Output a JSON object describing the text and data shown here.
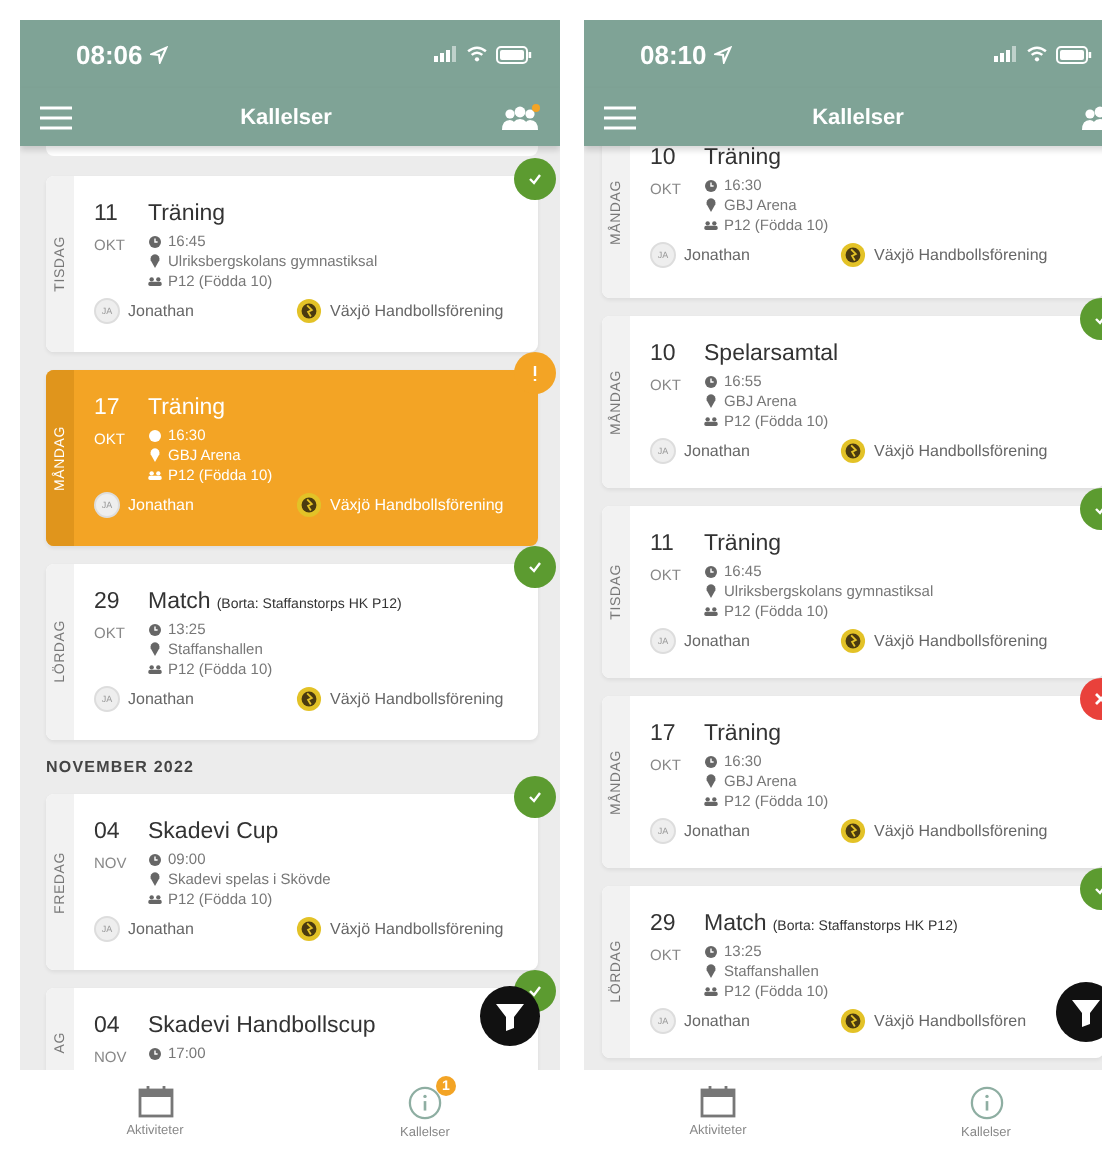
{
  "phones": [
    {
      "status_bar": {
        "time": "08:06"
      },
      "nav": {
        "title": "Kallelser",
        "notification_dot": true
      },
      "items": [
        {
          "kind": "edge"
        },
        {
          "kind": "accepted",
          "weekday": "TISDAG",
          "day": "11",
          "month": "OKT",
          "title": "Träning",
          "time": "16:45",
          "place": "Ulriksbergskolans gymnastiksal",
          "team": "P12 (Födda 10)",
          "initials": "JA",
          "person": "Jonathan",
          "club": "Växjö Handbollsförening"
        },
        {
          "kind": "pending",
          "weekday": "MÅNDAG",
          "day": "17",
          "month": "OKT",
          "title": "Träning",
          "time": "16:30",
          "place": "GBJ Arena",
          "team": "P12 (Födda 10)",
          "initials": "JA",
          "person": "Jonathan",
          "club": "Växjö Handbollsförening"
        },
        {
          "kind": "accepted",
          "weekday": "LÖRDAG",
          "day": "29",
          "month": "OKT",
          "title": "Match",
          "subtitle": "(Borta: Staffanstorps HK P12)",
          "time": "13:25",
          "place": "Staffanshallen",
          "team": "P12 (Födda 10)",
          "initials": "JA",
          "person": "Jonathan",
          "club": "Växjö Handbollsförening"
        },
        {
          "kind": "section",
          "label": "NOVEMBER 2022"
        },
        {
          "kind": "accepted",
          "weekday": "FREDAG",
          "day": "04",
          "month": "NOV",
          "title": "Skadevi Cup",
          "time": "09:00",
          "place": "Skadevi spelas i Skövde",
          "team": "P12 (Födda 10)",
          "initials": "JA",
          "person": "Jonathan",
          "club": "Växjö Handbollsförening"
        },
        {
          "kind": "accepted",
          "weekday": "AG",
          "day": "04",
          "month": "NOV",
          "title": "Skadevi Handbollscup",
          "time": "17:00"
        }
      ],
      "tabs": [
        {
          "label": "Aktiviteter",
          "selected": false
        },
        {
          "label": "Kallelser",
          "selected": true,
          "badge": "1"
        }
      ]
    },
    {
      "status_bar": {
        "time": "08:10"
      },
      "nav": {
        "title": "Kallelser"
      },
      "items": [
        {
          "kind": "cut",
          "weekday": "MÅNDAG",
          "day": "10",
          "month": "OKT",
          "title": "Träning",
          "time": "16:30",
          "place": "GBJ Arena",
          "team": "P12 (Födda 10)",
          "initials": "JA",
          "person": "Jonathan",
          "club": "Växjö Handbollsförening"
        },
        {
          "kind": "accepted",
          "weekday": "MÅNDAG",
          "day": "10",
          "month": "OKT",
          "title": "Spelarsamtal",
          "time": "16:55",
          "place": "GBJ Arena",
          "team": "P12 (Födda 10)",
          "initials": "JA",
          "person": "Jonathan",
          "club": "Växjö Handbollsförening"
        },
        {
          "kind": "accepted",
          "weekday": "TISDAG",
          "day": "11",
          "month": "OKT",
          "title": "Träning",
          "time": "16:45",
          "place": "Ulriksbergskolans gymnastiksal",
          "team": "P12 (Födda 10)",
          "initials": "JA",
          "person": "Jonathan",
          "club": "Växjö Handbollsförening"
        },
        {
          "kind": "declined",
          "weekday": "MÅNDAG",
          "day": "17",
          "month": "OKT",
          "title": "Träning",
          "time": "16:30",
          "place": "GBJ Arena",
          "team": "P12 (Födda 10)",
          "initials": "JA",
          "person": "Jonathan",
          "club": "Växjö Handbollsförening"
        },
        {
          "kind": "accepted",
          "weekday": "LÖRDAG",
          "day": "29",
          "month": "OKT",
          "title": "Match",
          "subtitle": "(Borta: Staffanstorps HK P12)",
          "time": "13:25",
          "place": "Staffanshallen",
          "team": "P12 (Födda 10)",
          "initials": "JA",
          "person": "Jonathan",
          "club": "Växjö Handbollsfören"
        }
      ],
      "tabs": [
        {
          "label": "Aktiviteter",
          "selected": false
        },
        {
          "label": "Kallelser",
          "selected": true
        }
      ]
    }
  ]
}
